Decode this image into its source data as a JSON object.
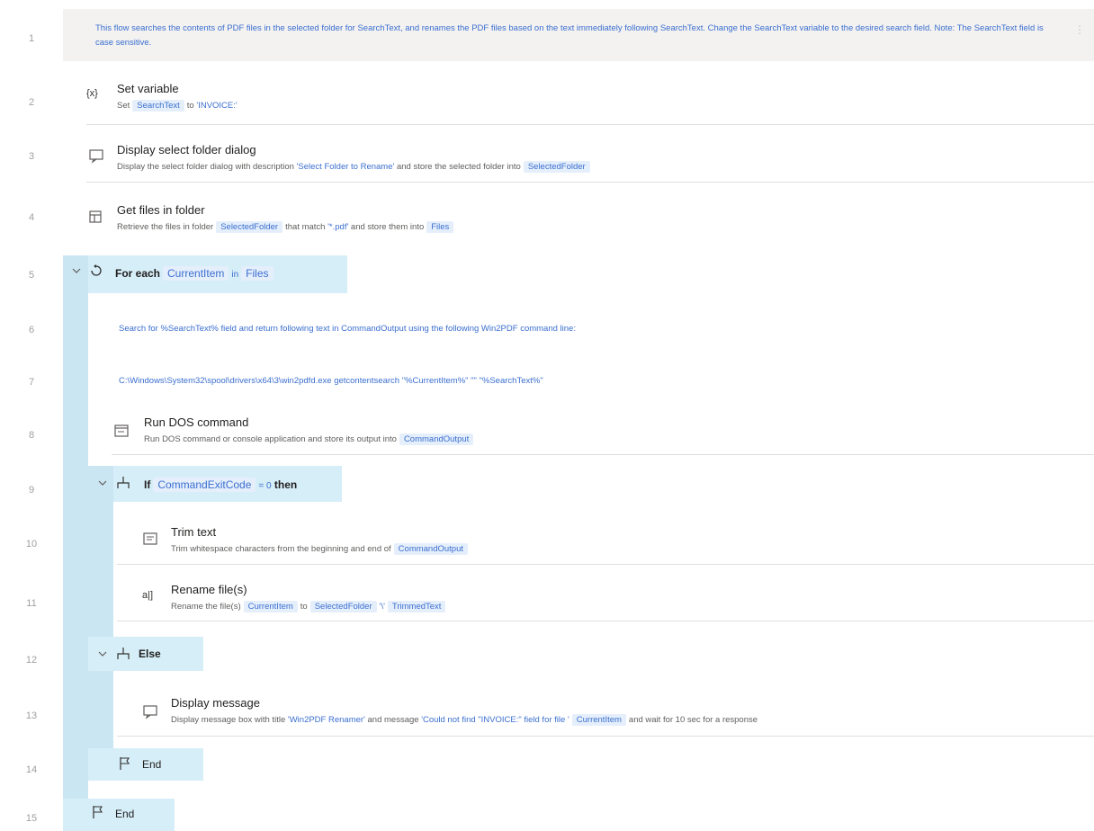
{
  "line_numbers": [
    "1",
    "2",
    "3",
    "4",
    "5",
    "6",
    "7",
    "8",
    "9",
    "10",
    "11",
    "12",
    "13",
    "14",
    "15"
  ],
  "steps": {
    "comment1": "This flow searches the contents of PDF files in the selected folder for SearchText, and renames the PDF files based on the text immediately following SearchText. Change the SearchText variable to the desired search field. Note: The SearchText field is case sensitive.",
    "set_variable": {
      "title": "Set variable",
      "icon_text": "{x}",
      "d1": "Set",
      "var": "SearchText",
      "d2": "to",
      "val": "'INVOICE:'"
    },
    "display_folder": {
      "title": "Display select folder dialog",
      "d1": "Display the select folder dialog with description",
      "lit": "'Select Folder to Rename'",
      "d2": "and store the selected folder into",
      "var": "SelectedFolder"
    },
    "get_files": {
      "title": "Get files in folder",
      "d1": "Retrieve the files in folder",
      "var": "SelectedFolder",
      "d2": "that match",
      "lit": "'*.pdf'",
      "d3": "and store them into",
      "out": "Files"
    },
    "for_each": {
      "kw": "For each",
      "var": "CurrentItem",
      "in": "in",
      "list": "Files"
    },
    "comment6": "Search for %SearchText% field and return following text in CommandOutput using the following Win2PDF command line:",
    "comment7": "C:\\Windows\\System32\\spool\\drivers\\x64\\3\\win2pdfd.exe getcontentsearch \"%CurrentItem%\" \"\" \"%SearchText%\"",
    "run_dos": {
      "title": "Run DOS command",
      "d1": "Run DOS command or console application and store its output into",
      "var": "CommandOutput"
    },
    "if": {
      "kw": "If",
      "var": "CommandExitCode",
      "op": "= 0",
      "then": "then"
    },
    "trim": {
      "title": "Trim text",
      "d1": "Trim whitespace characters from the beginning and end of",
      "var": "CommandOutput"
    },
    "rename": {
      "title": "Rename file(s)",
      "d1": "Rename the file(s)",
      "var": "CurrentItem",
      "d2": "to",
      "var2": "SelectedFolder",
      "lit": "'\\'",
      "var3": "TrimmedText"
    },
    "else": {
      "kw": "Else"
    },
    "display_msg": {
      "title": "Display message",
      "d1": "Display message box with title",
      "lit1": "'Win2PDF Renamer'",
      "d2": "and message",
      "lit2": "'Could not find \"INVOICE:\" field for file '",
      "var": "CurrentItem",
      "d3": "and wait for 10 sec for a response"
    },
    "end_inner": "End",
    "end_outer": "End"
  }
}
